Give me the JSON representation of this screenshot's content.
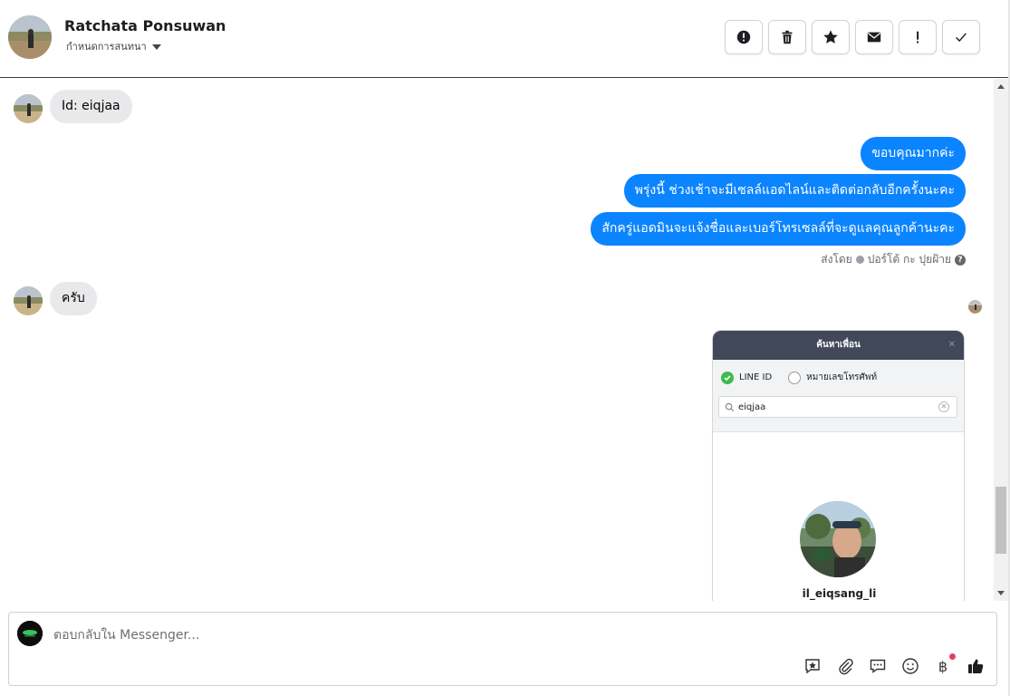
{
  "header": {
    "contact_name": "Ratchata Ponsuwan",
    "assign_label": "กำหนดการสนทนา",
    "actions": [
      {
        "name": "spam-button",
        "icon": "alert-circle-icon"
      },
      {
        "name": "delete-button",
        "icon": "trash-icon"
      },
      {
        "name": "star-button",
        "icon": "star-icon"
      },
      {
        "name": "mark-unread-button",
        "icon": "envelope-icon"
      },
      {
        "name": "follow-up-button",
        "icon": "exclamation-icon"
      },
      {
        "name": "mark-done-button",
        "icon": "checkmark-icon"
      }
    ]
  },
  "messages": {
    "incoming_1": "Id: eiqjaa",
    "outgoing": [
      "ขอบคุณมากค่ะ",
      "พรุ่งนี้ ช่วงเช้าจะมีเซลล์แอดไลน์และติดต่อกลับอีกครั้งนะคะ",
      "สักครู่แอดมินจะแจ้งชื่อและเบอร์โทรเซลล์ที่จะดูแลคุณลูกค้านะคะ"
    ],
    "sent_by_prefix": "ส่งโดย",
    "sent_by_name": "ปอร์โต้ กะ ปุยฝ้าย",
    "incoming_2": "ครับ"
  },
  "attachment": {
    "title": "ค้นหาเพื่อน",
    "option_line_id": "LINE ID",
    "option_phone": "หมายเลขโทรศัพท์",
    "search_value": "eiqjaa",
    "result_name": "il_eiqsang_li"
  },
  "composer": {
    "placeholder": "ตอบกลับใน Messenger...",
    "currency_symbol": "฿"
  },
  "colors": {
    "outgoing_bubble": "#0b84ff",
    "incoming_bubble": "#e9e9eb",
    "line_green": "#3ebb4f",
    "line_header": "#414859"
  }
}
